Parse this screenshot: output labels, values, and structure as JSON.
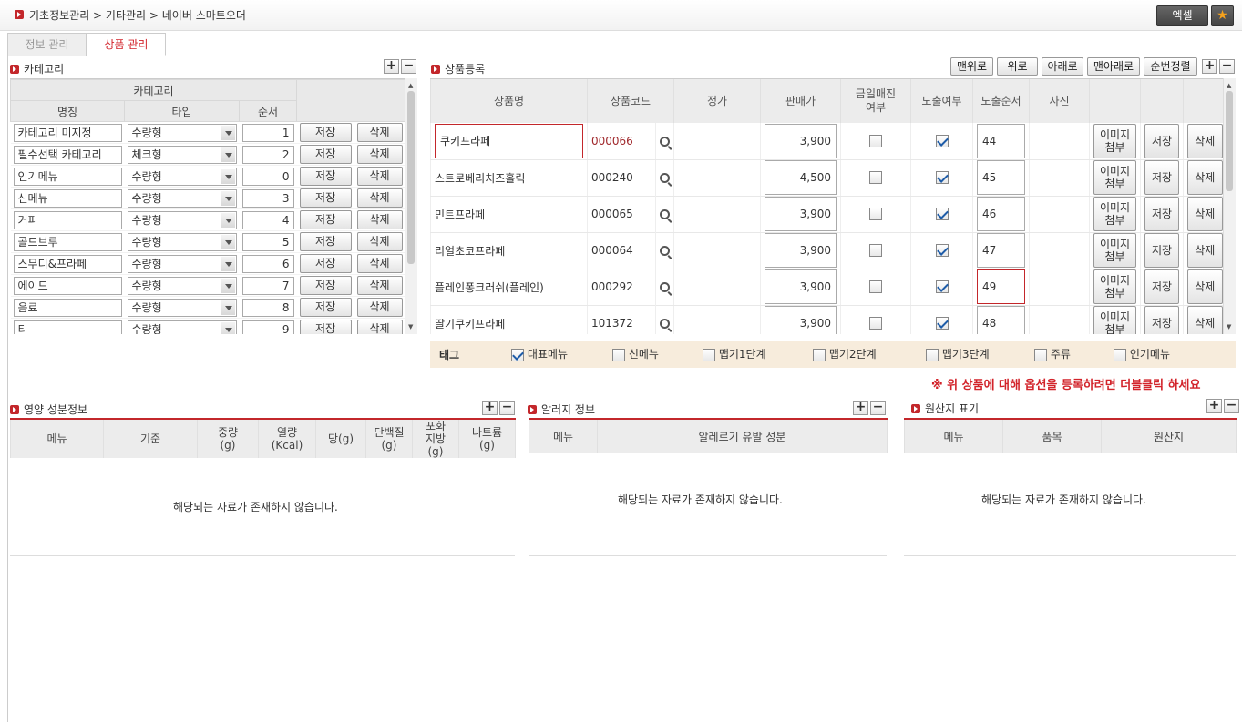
{
  "breadcrumb": "기초정보관리 > 기타관리 > 네이버 스마트오더",
  "toolbar": {
    "excel": "엑셀",
    "star": "★"
  },
  "tabs": [
    {
      "label": "정보 관리"
    },
    {
      "label": "상품 관리"
    }
  ],
  "category": {
    "title": "카테고리",
    "group_header": "카테고리",
    "headers": {
      "name": "명칭",
      "type": "타입",
      "order": "순서"
    },
    "save": "저장",
    "delete": "삭제",
    "rows": [
      {
        "name": "카테고리 미지정",
        "type": "수량형",
        "order": "1"
      },
      {
        "name": "필수선택 카테고리",
        "type": "체크형",
        "order": "2"
      },
      {
        "name": "인기메뉴",
        "type": "수량형",
        "order": "0"
      },
      {
        "name": "신메뉴",
        "type": "수량형",
        "order": "3"
      },
      {
        "name": "커피",
        "type": "수량형",
        "order": "4"
      },
      {
        "name": "콜드브루",
        "type": "수량형",
        "order": "5"
      },
      {
        "name": "스무디&프라페",
        "type": "수량형",
        "order": "6"
      },
      {
        "name": "에이드",
        "type": "수량형",
        "order": "7"
      },
      {
        "name": "음료",
        "type": "수량형",
        "order": "8"
      },
      {
        "name": "티",
        "type": "수량형",
        "order": "9"
      }
    ]
  },
  "product": {
    "title": "상품등록",
    "buttons": {
      "top": "맨위로",
      "up": "위로",
      "down": "아래로",
      "bottom": "맨아래로",
      "renumber": "순번정렬"
    },
    "headers": {
      "name": "상품명",
      "code": "상품코드",
      "list_price": "정가",
      "price": "판매가",
      "soldout": "금일매진\n여부",
      "visible": "노출여부",
      "order": "노출순서",
      "photo": "사진"
    },
    "img_btn": "이미지\n첨부",
    "save": "저장",
    "delete": "삭제",
    "rows": [
      {
        "name": "쿠키프라페",
        "code": "000066",
        "price": "3,900",
        "soldout": false,
        "visible": true,
        "order": "44"
      },
      {
        "name": "스트로베리치즈홀릭",
        "code": "000240",
        "price": "4,500",
        "soldout": false,
        "visible": true,
        "order": "45"
      },
      {
        "name": "민트프라페",
        "code": "000065",
        "price": "3,900",
        "soldout": false,
        "visible": true,
        "order": "46"
      },
      {
        "name": "리얼초코프라페",
        "code": "000064",
        "price": "3,900",
        "soldout": false,
        "visible": true,
        "order": "47"
      },
      {
        "name": "플레인퐁크러쉬(플레인)",
        "code": "000292",
        "price": "3,900",
        "soldout": false,
        "visible": true,
        "order": "49"
      },
      {
        "name": "딸기쿠키프라페",
        "code": "101372",
        "price": "3,900",
        "soldout": false,
        "visible": true,
        "order": "48"
      }
    ]
  },
  "tags": {
    "label": "태그",
    "items": [
      {
        "label": "대표메뉴",
        "checked": true
      },
      {
        "label": "신메뉴",
        "checked": false
      },
      {
        "label": "맵기1단계",
        "checked": false
      },
      {
        "label": "맵기2단계",
        "checked": false
      },
      {
        "label": "맵기3단계",
        "checked": false
      },
      {
        "label": "주류",
        "checked": false
      },
      {
        "label": "인기메뉴",
        "checked": false
      }
    ]
  },
  "notice": "※ 위 상품에 대해 옵션을 등록하려면 더블클릭 하세요",
  "nutrition": {
    "title": "영양 성분정보",
    "headers": [
      "메뉴",
      "기준",
      "중량\n(g)",
      "열량\n(Kcal)",
      "당(g)",
      "단백질\n(g)",
      "포화\n지방\n(g)",
      "나트륨\n(g)"
    ],
    "empty": "해당되는 자료가 존재하지 않습니다."
  },
  "allergy": {
    "title": "알러지 정보",
    "headers": [
      "메뉴",
      "알레르기 유발 성분"
    ],
    "empty": "해당되는 자료가 존재하지 않습니다."
  },
  "origin": {
    "title": "원산지 표기",
    "headers": [
      "메뉴",
      "품목",
      "원산지"
    ],
    "empty": "해당되는 자료가 존재하지 않습니다."
  }
}
